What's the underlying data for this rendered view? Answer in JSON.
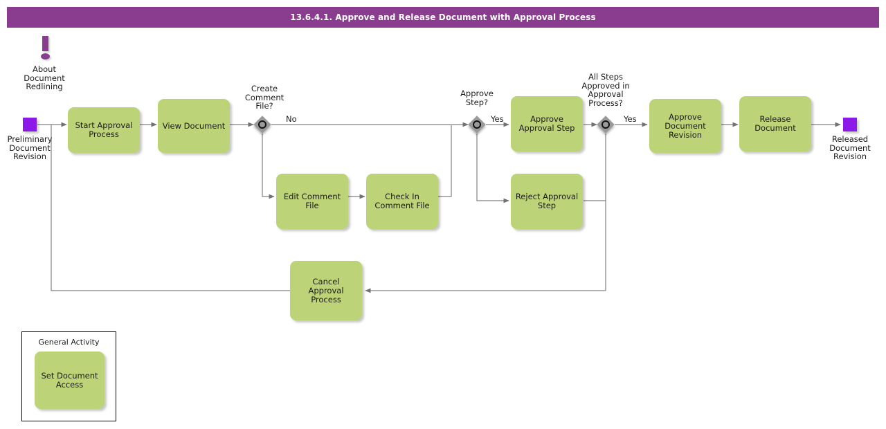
{
  "header": {
    "title": "13.6.4.1. Approve and Release Document with Approval Process",
    "bar_color": "#8a3d8f"
  },
  "theme": {
    "activity_fill": "#bcd377",
    "event_fill": "#8b19e8",
    "gateway_fill": "#9a9a9a",
    "connector_color": "#808080",
    "annotation_color": "#8a3d8f"
  },
  "annotation": {
    "icon": "exclamation-icon",
    "label": "About\nDocument\nRedlining"
  },
  "events": [
    {
      "name": "start-event",
      "label": "Preliminary\nDocument\nRevision"
    },
    {
      "name": "end-event",
      "label": "Released\nDocument\nRevision"
    }
  ],
  "tasks": [
    {
      "name": "start-approval-process",
      "label": "Start Approval\nProcess"
    },
    {
      "name": "view-document",
      "label": "View Document"
    },
    {
      "name": "edit-comment-file",
      "label": "Edit Comment\nFile"
    },
    {
      "name": "check-in-comment-file",
      "label": "Check In\nComment File"
    },
    {
      "name": "approve-approval-step",
      "label": "Approve\nApproval Step"
    },
    {
      "name": "reject-approval-step",
      "label": "Reject Approval\nStep"
    },
    {
      "name": "approve-document-revision",
      "label": "Approve\nDocument\nRevision"
    },
    {
      "name": "release-document",
      "label": "Release\nDocument"
    },
    {
      "name": "cancel-approval-process",
      "label": "Cancel Approval\nProcess"
    }
  ],
  "gateways": [
    {
      "name": "create-comment-file-gateway",
      "label": "Create\nComment\nFile?"
    },
    {
      "name": "approve-step-gateway",
      "label": "Approve\nStep?"
    },
    {
      "name": "all-steps-approved-gateway",
      "label": "All Steps\nApproved in\nApproval\nProcess?"
    }
  ],
  "flow_labels": [
    {
      "name": "flow-label-no",
      "text": "No"
    },
    {
      "name": "flow-label-yes-approve-step",
      "text": "Yes"
    },
    {
      "name": "flow-label-yes-all-steps",
      "text": "Yes"
    }
  ],
  "legend": {
    "title": "General Activity",
    "task_label": "Set Document\nAccess"
  }
}
